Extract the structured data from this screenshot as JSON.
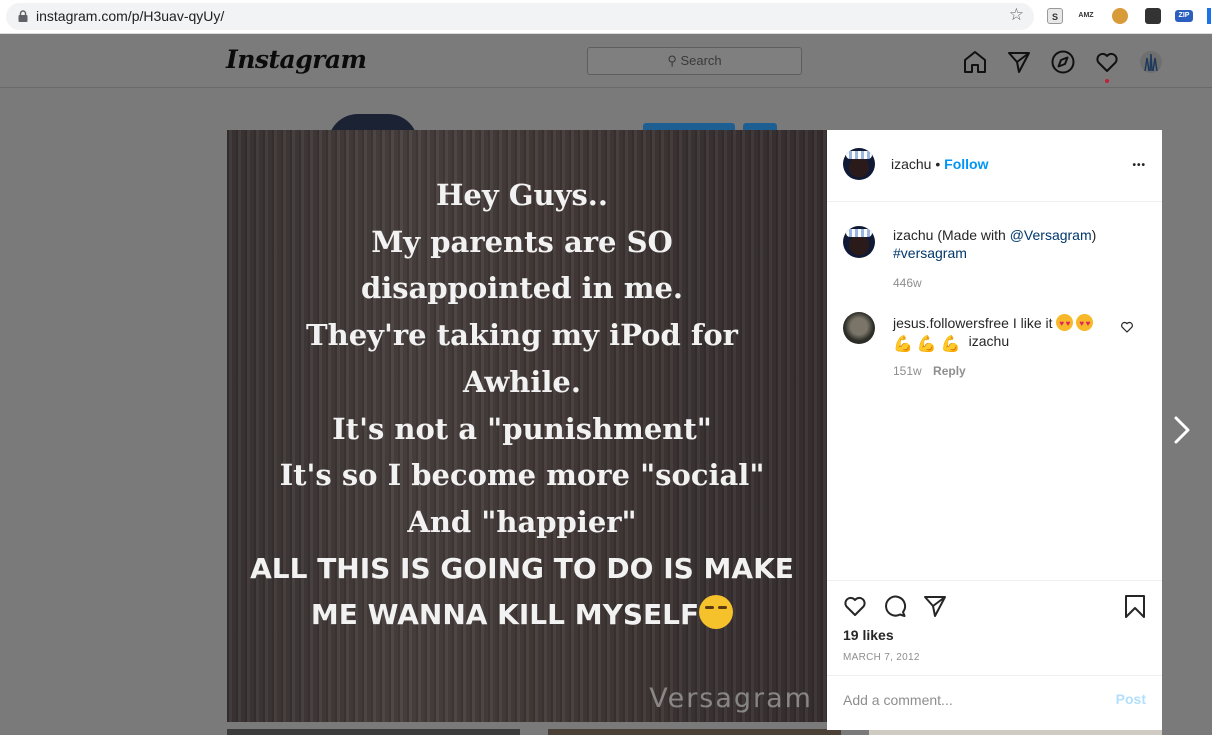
{
  "browser": {
    "url": "instagram.com/p/H3uav-qyUy/",
    "extensions": [
      "S",
      "AMZ",
      "cookie",
      "pin",
      "ZIP"
    ]
  },
  "header": {
    "logo": "Instagram",
    "search_placeholder": "Search",
    "icons": [
      "home-icon",
      "direct-icon",
      "explore-icon",
      "activity-icon",
      "profile-icon"
    ]
  },
  "post": {
    "image_lines": [
      "Hey Guys..",
      "My parents are SO",
      "disappointed in me.",
      "They're taking my iPod for",
      "Awhile.",
      "It's not a \"punishment\"",
      "It's so I become more \"social\"",
      "And \"happier\"",
      "ALL THIS IS GOING TO DO IS MAKE",
      "ME WANNA KILL MYSELF"
    ],
    "watermark": "Versagram",
    "author": "izachu",
    "separator": "•",
    "follow_label": "Follow",
    "more_label": "•••",
    "caption": {
      "username": "izachu",
      "text": "(Made with ",
      "mention": "@Versagram",
      "close": ")",
      "hashtag": "#versagram",
      "time": "446w"
    },
    "comments": [
      {
        "username": "jesus.followersfree",
        "text": "I like it",
        "mention": "izachu",
        "time": "151w",
        "reply_label": "Reply"
      }
    ],
    "likes": "19 likes",
    "date": "MARCH 7, 2012",
    "comment_placeholder": "Add a comment...",
    "post_label": "Post"
  },
  "colors": {
    "accent": "#0095f6",
    "link": "#00376b",
    "muted": "#8e8e8e",
    "post_disabled": "#b2dffc"
  }
}
